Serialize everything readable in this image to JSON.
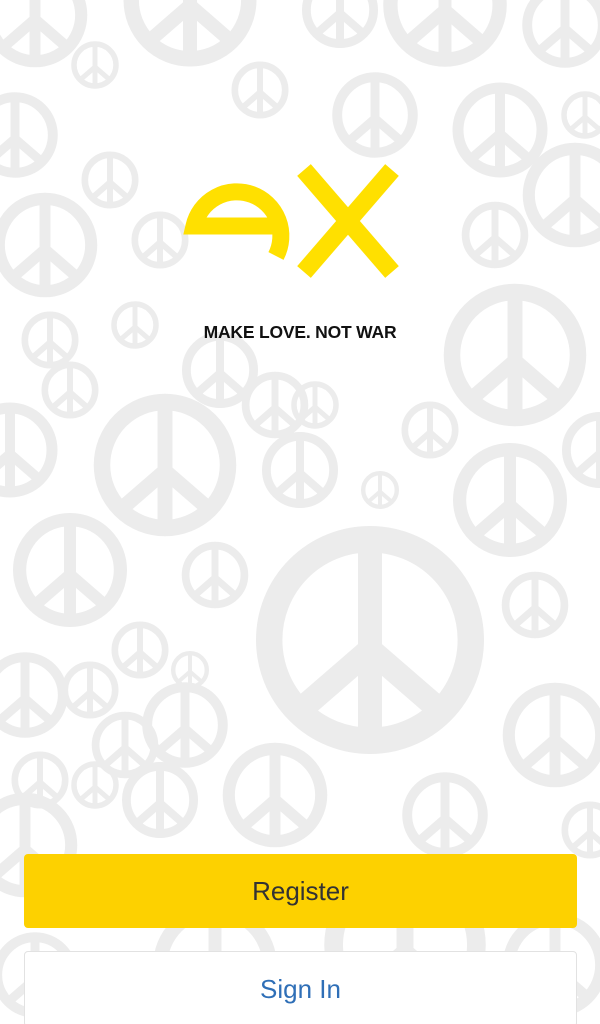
{
  "app": {
    "logo_text": "ex",
    "tagline": "MAKE LOVE. NOT WAR"
  },
  "background": {
    "pattern_icon": "peace-sign-icon",
    "pattern_color": "#ececec"
  },
  "actions": {
    "register_label": "Register",
    "signin_label": "Sign In"
  },
  "colors": {
    "brand_yellow": "#FDD100",
    "logo_yellow": "#FFE000",
    "link_blue": "#2F6FB7"
  }
}
